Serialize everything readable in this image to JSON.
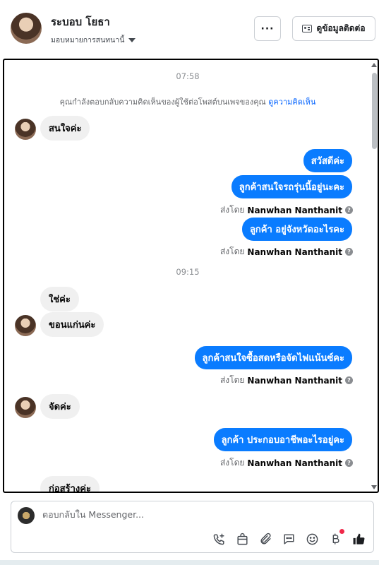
{
  "header": {
    "contact_name": "ระบอบ โยธา",
    "assign_label": "มอบหมายการสนทนานี้",
    "more_label": "···",
    "contact_info_label": "ดูข้อมูลติดต่อ"
  },
  "conversation": {
    "time_1": "07:58",
    "system_text": "คุณกำลังตอบกลับความคิดเห็นของผู้ใช้ต่อโพสต์บนเพจของคุณ",
    "system_link": "ดูความคิดเห็น",
    "time_2": "09:15",
    "sent_by_prefix": "ส่งโดย",
    "sender_name": "Nanwhan Nanthanit",
    "messages": [
      {
        "dir": "in",
        "text": "สนใจค่ะ"
      },
      {
        "dir": "out",
        "text": "สวัสดีค่ะ"
      },
      {
        "dir": "out",
        "text": "ลูกค้าสนใจรถรุ่นนี้อยู่นะคะ"
      },
      {
        "dir": "out",
        "text": "ลูกค้า อยู่จังหวัดอะไรคะ"
      },
      {
        "dir": "in",
        "text": "ใช่ค่ะ"
      },
      {
        "dir": "in",
        "text": "ขอนแก่นค่ะ"
      },
      {
        "dir": "out",
        "text": "ลูกค้าสนใจซื้อสดหรือจัดไฟแน้นซ์คะ"
      },
      {
        "dir": "in",
        "text": "จัดค่ะ"
      },
      {
        "dir": "out",
        "text": "ลูกค้า ประกอบอาชีพอะไรอยู่คะ"
      },
      {
        "dir": "in",
        "text": "ก่อสร้างค่ะ"
      }
    ]
  },
  "composer": {
    "placeholder": "ตอบกลับใน Messenger...",
    "icons": [
      "phone-add-icon",
      "shopping-bag-icon",
      "paperclip-icon",
      "chat-bubble-icon",
      "smiley-icon",
      "baht-icon",
      "thumbs-up-icon"
    ],
    "thumbs_color": "#1c1e21",
    "accent_color": "#0a7cff"
  }
}
